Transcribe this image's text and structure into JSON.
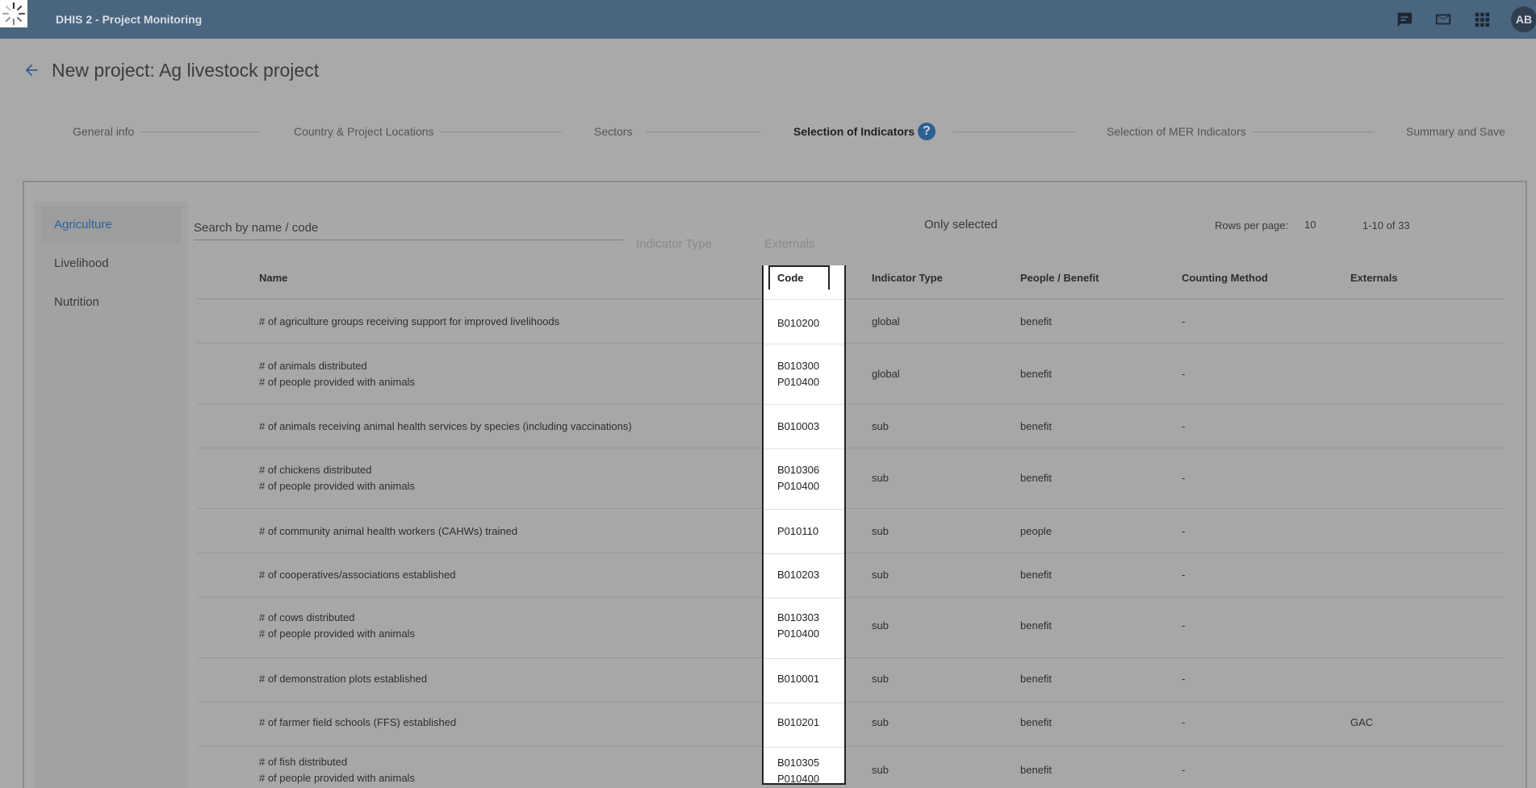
{
  "header": {
    "app_title": "DHIS 2 - Project Monitoring",
    "icons": [
      "chat-icon",
      "mail-icon",
      "apps-icon"
    ],
    "avatar_initials": "AB"
  },
  "page": {
    "title": "New project: Ag livestock project"
  },
  "stepper": {
    "steps": [
      {
        "label": "General info"
      },
      {
        "label": "Country & Project Locations"
      },
      {
        "label": "Sectors"
      },
      {
        "label": "Selection of Indicators"
      },
      {
        "label": "Selection of MER Indicators"
      },
      {
        "label": "Summary and Save"
      }
    ],
    "active_index": 3,
    "help_label": "?"
  },
  "sidebar": {
    "items": [
      {
        "label": "Agriculture",
        "active": true
      },
      {
        "label": "Livelihood",
        "active": false
      },
      {
        "label": "Nutrition",
        "active": false
      }
    ]
  },
  "filters": {
    "search_placeholder": "Search by name / code",
    "indicator_type": "Indicator Type",
    "externals": "Externals",
    "only_selected": "Only selected"
  },
  "pagination": {
    "rows_per_page_label": "Rows per page:",
    "rows_per_page": "10",
    "range": "1-10 of 33"
  },
  "table": {
    "columns": {
      "name": "Name",
      "code": "Code",
      "indicator_type": "Indicator Type",
      "people_benefit": "People / Benefit",
      "counting_method": "Counting Method",
      "externals": "Externals"
    },
    "rows": [
      {
        "name1": "# of agriculture groups receiving support for improved livelihoods",
        "name2": "",
        "code1": "B010200",
        "code2": "",
        "type": "global",
        "pb": "benefit",
        "cm": "-",
        "ext": ""
      },
      {
        "name1": "# of animals distributed",
        "name2": "# of people provided with animals",
        "code1": "B010300",
        "code2": "P010400",
        "type": "global",
        "pb": "benefit",
        "cm": "-",
        "ext": ""
      },
      {
        "name1": "# of animals receiving animal health services by species (including vaccinations)",
        "name2": "",
        "code1": "B010003",
        "code2": "",
        "type": "sub",
        "pb": "benefit",
        "cm": "-",
        "ext": ""
      },
      {
        "name1": "# of chickens distributed",
        "name2": "# of people provided with animals",
        "code1": "B010306",
        "code2": "P010400",
        "type": "sub",
        "pb": "benefit",
        "cm": "-",
        "ext": ""
      },
      {
        "name1": "# of community animal health workers (CAHWs) trained",
        "name2": "",
        "code1": "P010110",
        "code2": "",
        "type": "sub",
        "pb": "people",
        "cm": "-",
        "ext": ""
      },
      {
        "name1": "# of cooperatives/associations established",
        "name2": "",
        "code1": "B010203",
        "code2": "",
        "type": "sub",
        "pb": "benefit",
        "cm": "-",
        "ext": ""
      },
      {
        "name1": "# of cows distributed",
        "name2": "# of people provided with animals",
        "code1": "B010303",
        "code2": "P010400",
        "type": "sub",
        "pb": "benefit",
        "cm": "-",
        "ext": ""
      },
      {
        "name1": "# of demonstration plots established",
        "name2": "",
        "code1": "B010001",
        "code2": "",
        "type": "sub",
        "pb": "benefit",
        "cm": "-",
        "ext": ""
      },
      {
        "name1": "# of farmer field schools (FFS) established",
        "name2": "",
        "code1": "B010201",
        "code2": "",
        "type": "sub",
        "pb": "benefit",
        "cm": "-",
        "ext": "GAC"
      },
      {
        "name1": "# of fish distributed",
        "name2": "# of people provided with animals",
        "code1": "B010305",
        "code2": "P010400",
        "type": "sub",
        "pb": "benefit",
        "cm": "-",
        "ext": ""
      }
    ]
  }
}
